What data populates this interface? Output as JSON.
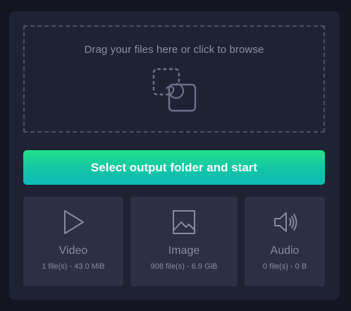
{
  "dropzone": {
    "label": "Drag your files here or click to browse",
    "icon": "drag-drop-icon"
  },
  "start_button": {
    "label": "Select output folder and start"
  },
  "categories": [
    {
      "id": "video",
      "title": "Video",
      "info": "1 file(s) - 43.0 MiB",
      "icon": "play-icon"
    },
    {
      "id": "image",
      "title": "Image",
      "info": "908 file(s) - 6.9 GiB",
      "icon": "image-icon"
    },
    {
      "id": "audio",
      "title": "Audio",
      "info": "0 file(s) - 0 B",
      "icon": "speaker-icon"
    }
  ],
  "colors": {
    "background": "#141722",
    "panel": "#1f2232",
    "tile": "#2c3044",
    "accent_start": "#1fe28a",
    "accent_end": "#10b8b8",
    "muted_text": "#868aa0"
  }
}
